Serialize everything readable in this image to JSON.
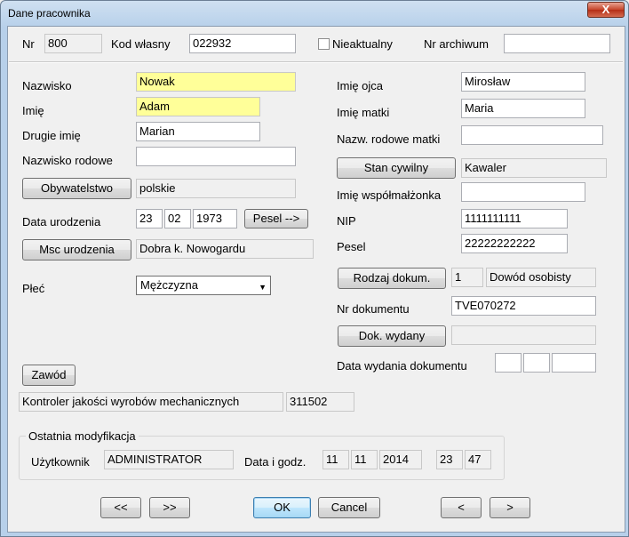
{
  "window": {
    "title": "Dane pracownika",
    "close": "X"
  },
  "top": {
    "nr_label": "Nr",
    "nr_value": "800",
    "kod_label": "Kod własny",
    "kod_value": "022932",
    "nieaktualny_label": "Nieaktualny",
    "nieaktualny_checked": false,
    "archiwum_label": "Nr archiwum",
    "archiwum_value": ""
  },
  "left": {
    "nazwisko_label": "Nazwisko",
    "nazwisko_value": "Nowak",
    "imie_label": "Imię",
    "imie_value": "Adam",
    "drugie_label": "Drugie imię",
    "drugie_value": "Marian",
    "rodowe_label": "Nazwisko rodowe",
    "rodowe_value": "",
    "obywatelstwo_button": "Obywatelstwo",
    "obywatelstwo_value": "polskie",
    "data_label": "Data urodzenia",
    "data_day": "23",
    "data_month": "02",
    "data_year": "1973",
    "pesel_button": "Pesel -->",
    "msc_button": "Msc urodzenia",
    "msc_value": "Dobra k. Nowogardu",
    "plec_label": "Płeć",
    "plec_value": "Mężczyzna",
    "zawod_button": "Zawód",
    "zawod_value": "Kontroler jakości wyrobów mechanicznych",
    "zawod_code": "311502"
  },
  "right": {
    "ojciec_label": "Imię ojca",
    "ojciec_value": "Mirosław",
    "matka_label": "Imię matki",
    "matka_value": "Maria",
    "matka_rodowe_label": "Nazw. rodowe matki",
    "matka_rodowe_value": "",
    "stan_button": "Stan cywilny",
    "stan_value": "Kawaler",
    "malzonek_label": "Imię współmałżonka",
    "malzonek_value": "",
    "nip_label": "NIP",
    "nip_value": "1111111111",
    "pesel_label": "Pesel",
    "pesel_value": "22222222222",
    "rodzaj_button": "Rodzaj dokum.",
    "rodzaj_code": "1",
    "rodzaj_value": "Dowód osobisty",
    "nrdok_label": "Nr dokumentu",
    "nrdok_value": "TVE070272",
    "wydany_button": "Dok. wydany",
    "wydany_value": "",
    "datawyd_label": "Data wydania dokumentu"
  },
  "modyfikacja": {
    "group_title": "Ostatnia modyfikacja",
    "user_label": "Użytkownik",
    "user_value": "ADMINISTRATOR",
    "date_label": "Data i godz.",
    "day": "11",
    "month": "11",
    "year": "2014",
    "hour": "23",
    "minute": "47"
  },
  "buttons": {
    "first": "<<",
    "last": ">>",
    "ok": "OK",
    "cancel": "Cancel",
    "prev": "<",
    "next": ">"
  }
}
